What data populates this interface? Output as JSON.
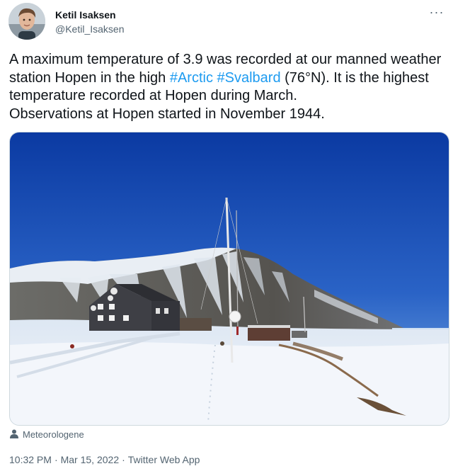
{
  "author": {
    "name": "Ketil Isaksen",
    "handle": "@Ketil_Isaksen",
    "avatar_icon": "profile-photo"
  },
  "menu": {
    "more_label": "···",
    "more_icon": "more-horizontal-icon"
  },
  "tweet": {
    "line1": "A maximum temperature of 3.9 was recorded at our manned weather",
    "line2_pre": "station Hopen in the high ",
    "hashtag1": "#Arctic",
    "space": " ",
    "hashtag2": "#Svalbard",
    "line2_post": " (76°N). It is the highest",
    "line3": "temperature recorded at Hopen during March.",
    "line4": "Observations at Hopen started in November 1944."
  },
  "media": {
    "tagged_user": "Meteorologene",
    "tag_icon": "person-icon"
  },
  "footer": {
    "time": "10:32 PM",
    "date": "Mar 15, 2022",
    "source": "Twitter Web App",
    "separator": "·"
  },
  "colors": {
    "text": "#0f1419",
    "secondary": "#536471",
    "link": "#1d9bf0",
    "sky_top": "#0d3fa8",
    "sky_bottom": "#5b93d8",
    "snow": "#eef3f9"
  }
}
